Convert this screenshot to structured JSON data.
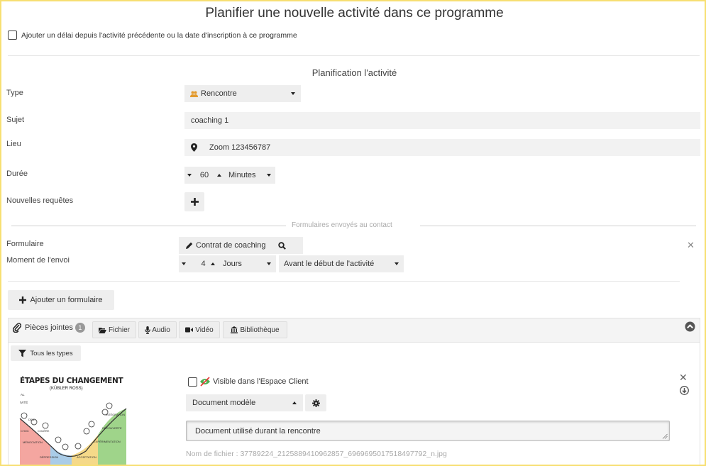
{
  "header": {
    "title": "Planifier une nouvelle activité dans ce programme",
    "delay_checkbox_label": "Ajouter un délai depuis l'activité précédente ou la date d'inscription à ce programme"
  },
  "planning": {
    "title": "Planification l'activité",
    "type_label": "Type",
    "type_value": "Rencontre",
    "subject_label": "Sujet",
    "subject_value": "coaching 1",
    "place_label": "Lieu",
    "place_value": "Zoom 123456787",
    "duration_label": "Durée",
    "duration_value": "60",
    "duration_unit": "Minutes",
    "requests_label": "Nouvelles requêtes"
  },
  "forms": {
    "legend": "Formulaires envoyés au contact",
    "form_label": "Formulaire",
    "form_value": "Contrat de coaching",
    "send_moment_label": "Moment de l'envoi",
    "send_amount": "4",
    "send_unit": "Jours",
    "send_when": "Avant le début de l'activité",
    "add_form_button": "Ajouter un formulaire"
  },
  "attachments": {
    "title": "Pièces jointes",
    "count": "1",
    "buttons": [
      "Fichier",
      "Audio",
      "Vidéo",
      "Bibliothèque"
    ],
    "filter_label": "Tous les types",
    "item": {
      "visible_label": "Visible dans l'Espace Client",
      "template_value": "Document modèle",
      "description": "Document utilisé durant la rencontre",
      "filename": "Nom de fichier : 37789224_2125889410962857_6969695017518497792_n.jpg",
      "thumbnail": {
        "heading": "ÉTAPES DU CHANGEMENT",
        "subheading": "(KÜBLER ROSS)",
        "left_marks": [
          "AL",
          "IVITÉ"
        ],
        "stage_labels": [
          "CHOC",
          "DENI",
          "COLÈRE",
          "MÉNOCIATION",
          "DÉPRESSION",
          "ACCEPTATION",
          "INTÉGRATION",
          "EXPÉRIMENTATION",
          "DÉCOUVERTE"
        ]
      }
    }
  },
  "colors": {
    "frame_border": "#f7df72",
    "person_icon": "#e39a2d",
    "no_eye_icon": "#4caf50",
    "no_eye_slash": "#e53935"
  }
}
